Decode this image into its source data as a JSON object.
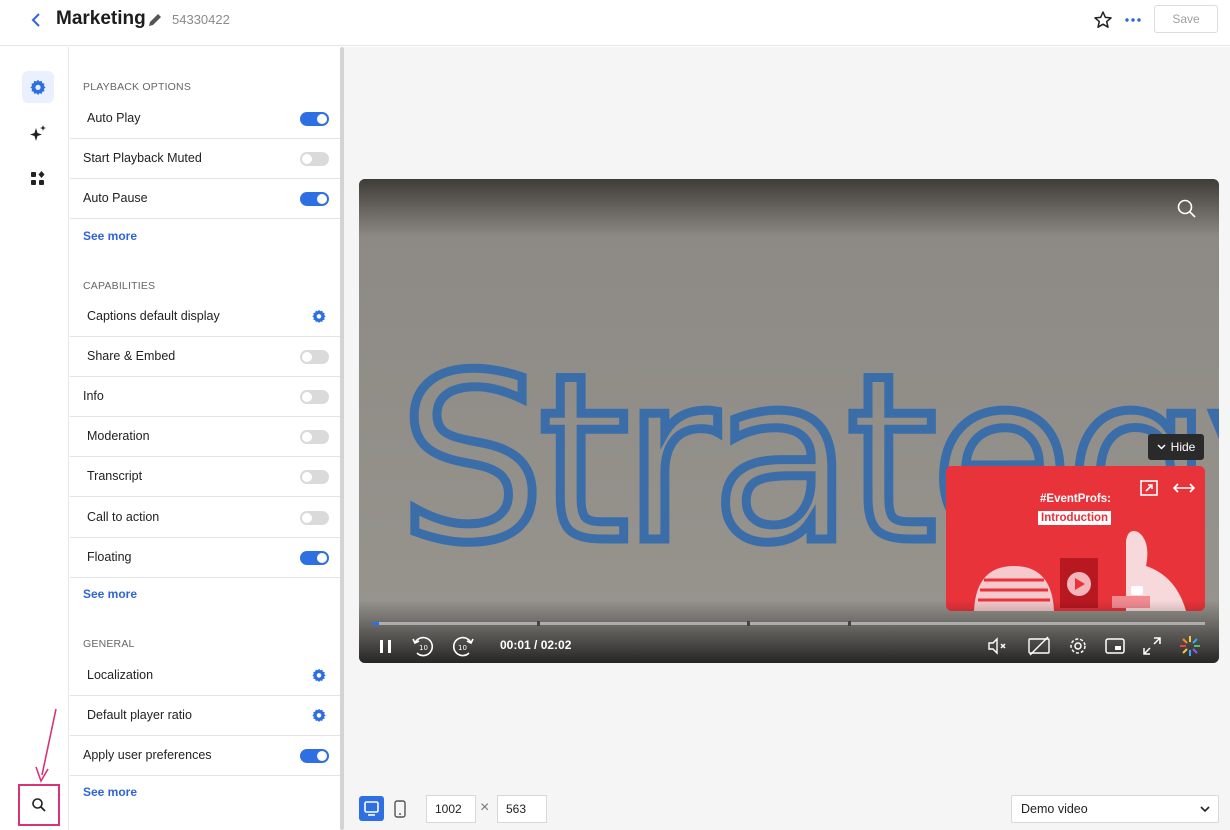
{
  "header": {
    "title": "Marketing",
    "player_id": "54330422",
    "save_label": "Save"
  },
  "rail": {
    "items": [
      "settings-icon",
      "sparkle-icon",
      "widgets-icon"
    ],
    "bottom": "search-icon"
  },
  "panel": {
    "sections": [
      {
        "title": "PLAYBACK OPTIONS",
        "rows": [
          {
            "label": "Auto Play",
            "control": "toggle",
            "on": true
          },
          {
            "label": "Start Playback Muted",
            "control": "toggle",
            "on": false
          },
          {
            "label": "Auto Pause",
            "control": "toggle",
            "on": true
          }
        ],
        "see_more": "See more"
      },
      {
        "title": "CAPABILITIES",
        "rows": [
          {
            "label": "Captions default display",
            "control": "gear"
          },
          {
            "label": "Share & Embed",
            "control": "toggle",
            "on": false
          },
          {
            "label": "Info",
            "control": "toggle",
            "on": false
          },
          {
            "label": "Moderation",
            "control": "toggle",
            "on": false
          },
          {
            "label": "Transcript",
            "control": "toggle",
            "on": false
          },
          {
            "label": "Call to action",
            "control": "toggle",
            "on": false
          },
          {
            "label": "Floating",
            "control": "toggle",
            "on": true
          }
        ],
        "see_more": "See more"
      },
      {
        "title": "GENERAL",
        "rows": [
          {
            "label": "Localization",
            "control": "gear"
          },
          {
            "label": "Default player ratio",
            "control": "gear"
          },
          {
            "label": "Apply user preferences",
            "control": "toggle",
            "on": true
          }
        ],
        "see_more": "See more"
      }
    ]
  },
  "video": {
    "board_text": "Strategy",
    "hide_label": "Hide",
    "time": "00:01 / 02:02",
    "progress": 0.008,
    "floating": {
      "tag": "#EventProfs:",
      "intro": "Introduction"
    }
  },
  "toolbar": {
    "width": "1002",
    "height": "563",
    "demo_select": "Demo video"
  },
  "colors": {
    "accent": "#2f6fe4",
    "annotation": "#d6337a",
    "floating_bg": "#e8303a"
  }
}
